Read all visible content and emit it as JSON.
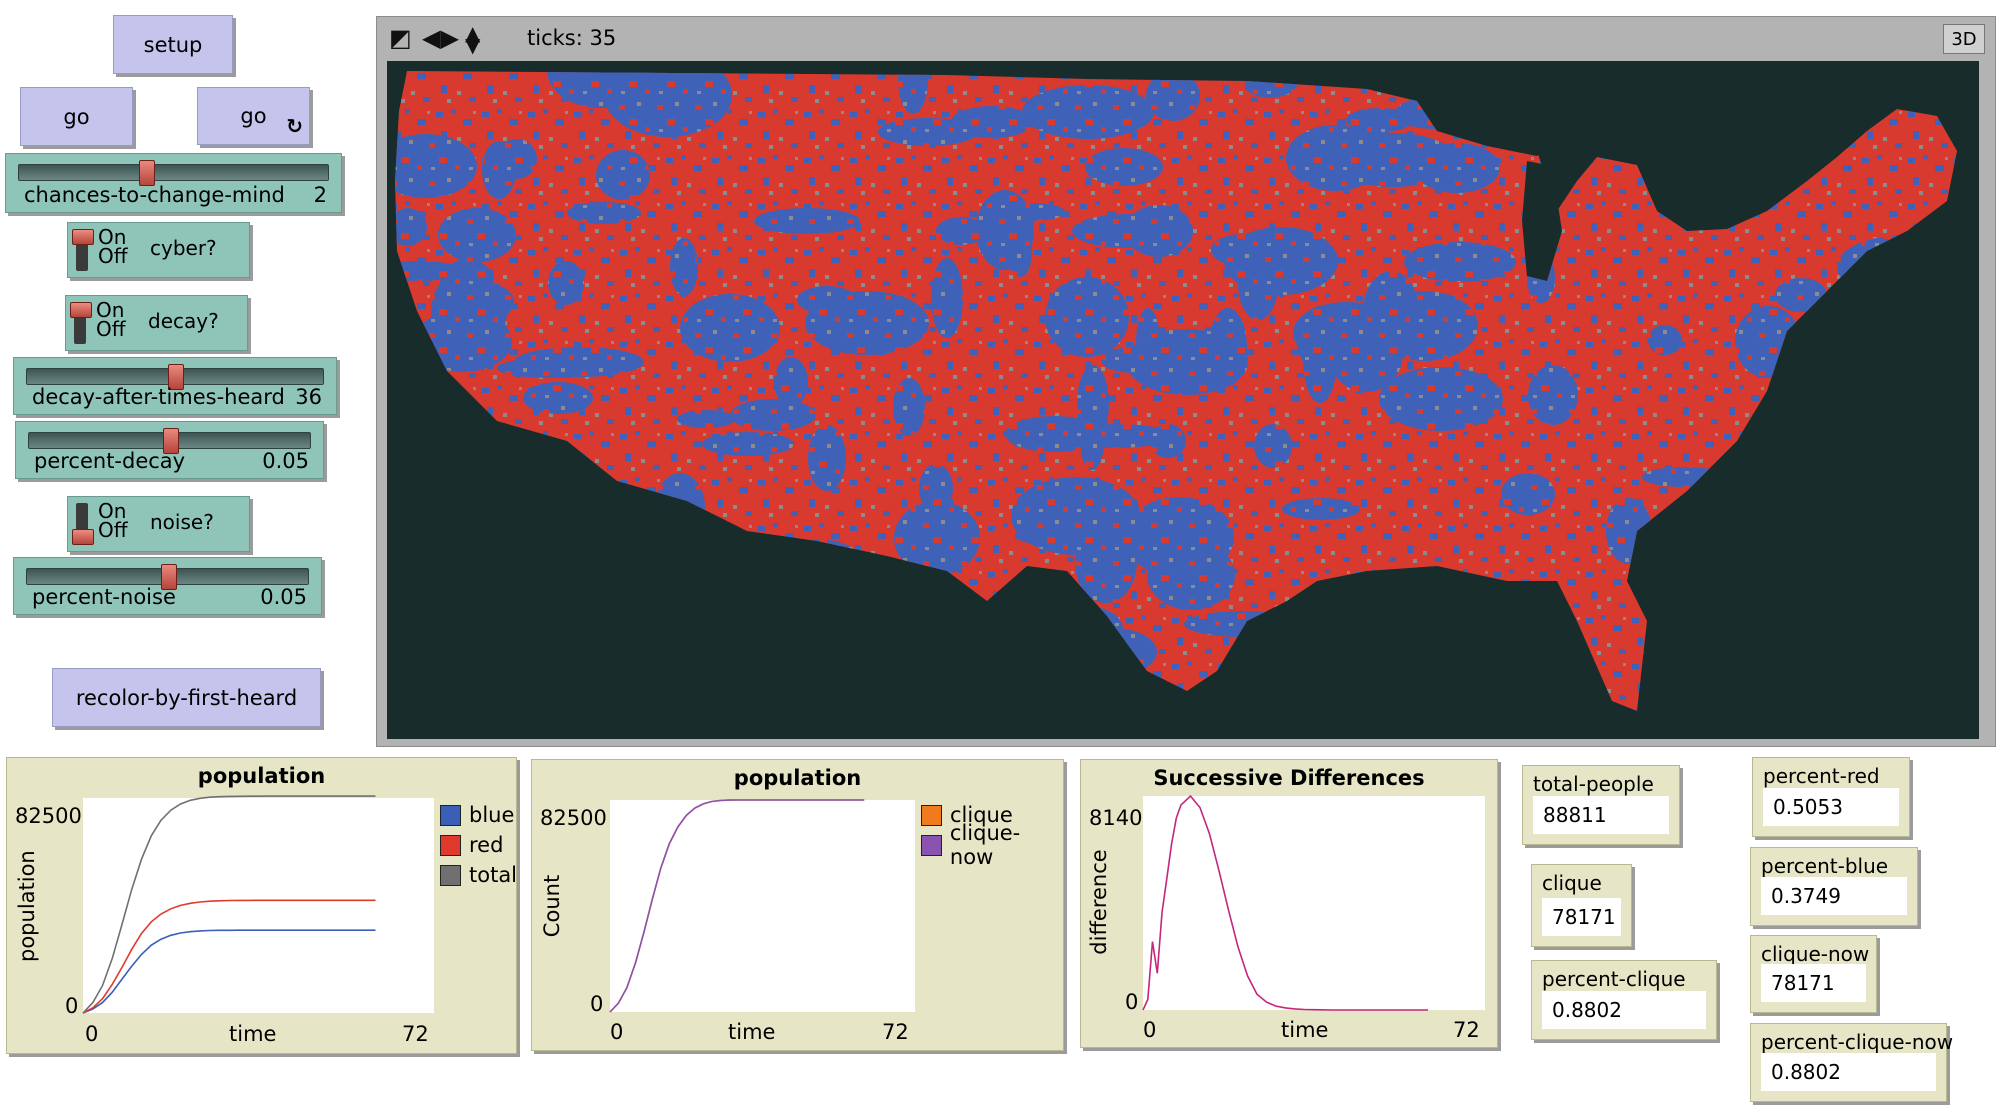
{
  "buttons": {
    "setup": "setup",
    "go_once": "go",
    "go_forever": "go",
    "recolor": "recolor-by-first-heard"
  },
  "sliders": [
    {
      "label": "chances-to-change-mind",
      "value": "2",
      "fraction": 0.41
    },
    {
      "label": "decay-after-times-heard",
      "value": "36",
      "fraction": 0.5
    },
    {
      "label": "percent-decay",
      "value": "0.05",
      "fraction": 0.5
    },
    {
      "label": "percent-noise",
      "value": "0.05",
      "fraction": 0.5
    }
  ],
  "switches": [
    {
      "label": "cyber?",
      "on": "On",
      "off": "Off",
      "state": "on"
    },
    {
      "label": "decay?",
      "on": "On",
      "off": "Off",
      "state": "on"
    },
    {
      "label": "noise?",
      "on": "On",
      "off": "Off",
      "state": "off"
    }
  ],
  "view": {
    "ticks_label": "ticks: 35",
    "three_d": "3D",
    "background_color": "#182c2c",
    "colors": {
      "blue": "#3f62b8",
      "red": "#d83a2f",
      "gray": "#8c8c8c"
    }
  },
  "chart_data": [
    {
      "type": "line",
      "title": "population",
      "xlabel": "time",
      "ylabel": "population",
      "x_range": [
        0,
        72
      ],
      "y_range": [
        0,
        82500
      ],
      "x_tick_labels": [
        "0",
        "72"
      ],
      "y_tick_labels": [
        "0",
        "82500"
      ],
      "legend": "right",
      "series": [
        {
          "name": "blue",
          "color": "#3a5fb8",
          "x": [
            0,
            2,
            4,
            6,
            8,
            10,
            12,
            14,
            16,
            18,
            20,
            22,
            24,
            26,
            28,
            30,
            32,
            34,
            36,
            38,
            40,
            44,
            48,
            52,
            56,
            60
          ],
          "y": [
            0,
            1500,
            4000,
            8000,
            13000,
            18000,
            22500,
            26000,
            28300,
            29800,
            30700,
            31200,
            31500,
            31650,
            31720,
            31750,
            31770,
            31780,
            31790,
            31790,
            31790,
            31790,
            31790,
            31790,
            31790,
            31790
          ]
        },
        {
          "name": "red",
          "color": "#e03a2c",
          "x": [
            0,
            2,
            4,
            6,
            8,
            10,
            12,
            14,
            16,
            18,
            20,
            22,
            24,
            26,
            28,
            30,
            32,
            34,
            36,
            38,
            40,
            44,
            48,
            52,
            56,
            60
          ],
          "y": [
            0,
            2000,
            5500,
            11000,
            17500,
            24500,
            30500,
            35000,
            38000,
            40000,
            41300,
            42100,
            42600,
            42900,
            43050,
            43150,
            43200,
            43220,
            43240,
            43250,
            43250,
            43250,
            43250,
            43250,
            43250,
            43250
          ]
        },
        {
          "name": "total",
          "color": "#707070",
          "x": [
            0,
            2,
            4,
            6,
            8,
            10,
            12,
            14,
            16,
            18,
            20,
            22,
            24,
            26,
            28,
            30,
            32,
            34,
            36,
            38,
            40,
            44,
            48,
            52,
            56,
            60
          ],
          "y": [
            0,
            4000,
            10500,
            21000,
            34000,
            47500,
            59000,
            68000,
            74000,
            77800,
            80200,
            81600,
            82400,
            82800,
            83000,
            83100,
            83150,
            83180,
            83200,
            83210,
            83210,
            83210,
            83210,
            83210,
            83210,
            83210
          ]
        }
      ]
    },
    {
      "type": "line",
      "title": "population",
      "xlabel": "time",
      "ylabel": "Count",
      "x_range": [
        0,
        72
      ],
      "y_range": [
        0,
        82500
      ],
      "x_tick_labels": [
        "0",
        "72"
      ],
      "y_tick_labels": [
        "0",
        "82500"
      ],
      "legend": "right",
      "series": [
        {
          "name": "clique",
          "color": "#f07a1c",
          "x": [
            0,
            2,
            4,
            6,
            8,
            10,
            12,
            14,
            16,
            18,
            20,
            22,
            24,
            26,
            28,
            30,
            32,
            34,
            36,
            38,
            40,
            44,
            48,
            52,
            56,
            60
          ],
          "y": [
            0,
            3500,
            9500,
            19000,
            31000,
            44000,
            56000,
            65500,
            72000,
            76500,
            79300,
            81000,
            81900,
            82300,
            82450,
            82500,
            82500,
            82500,
            82500,
            82500,
            82500,
            82500,
            82500,
            82500,
            82500,
            82500
          ]
        },
        {
          "name": "clique-now",
          "color": "#8b53b0",
          "x": [
            0,
            2,
            4,
            6,
            8,
            10,
            12,
            14,
            16,
            18,
            20,
            22,
            24,
            26,
            28,
            30,
            32,
            34,
            36,
            38,
            40,
            44,
            48,
            52,
            56,
            60
          ],
          "y": [
            0,
            3500,
            9500,
            19000,
            31000,
            44000,
            56000,
            65500,
            72000,
            76500,
            79300,
            81000,
            81900,
            82300,
            82450,
            82500,
            82500,
            82500,
            82500,
            82500,
            82500,
            82500,
            82500,
            82500,
            82500,
            82500
          ]
        }
      ]
    },
    {
      "type": "line",
      "title": "Successive Differences",
      "xlabel": "time",
      "ylabel": "difference",
      "x_range": [
        0,
        72
      ],
      "y_range": [
        0,
        8140
      ],
      "x_tick_labels": [
        "0",
        "72"
      ],
      "y_tick_labels": [
        "0",
        "8140"
      ],
      "series": [
        {
          "name": "",
          "color": "#c4267e",
          "x": [
            0,
            1,
            2,
            3,
            4,
            5,
            6,
            7,
            8,
            10,
            12,
            14,
            16,
            18,
            20,
            22,
            24,
            26,
            28,
            30,
            32,
            34,
            36,
            40,
            44,
            50,
            60
          ],
          "y": [
            0,
            400,
            2600,
            1400,
            3700,
            5000,
            6300,
            7300,
            7800,
            8140,
            7700,
            6700,
            5300,
            3800,
            2400,
            1300,
            600,
            300,
            150,
            80,
            40,
            20,
            10,
            0,
            0,
            0,
            0
          ]
        }
      ]
    }
  ],
  "plot_legends": [
    [
      "blue",
      "red",
      "total"
    ],
    [
      "clique",
      "clique-now"
    ]
  ],
  "monitors": {
    "total_people": {
      "label": "total-people",
      "value": "88811"
    },
    "clique": {
      "label": "clique",
      "value": "78171"
    },
    "percent_clique": {
      "label": "percent-clique",
      "value": "0.8802"
    },
    "percent_red": {
      "label": "percent-red",
      "value": "0.5053"
    },
    "percent_blue": {
      "label": "percent-blue",
      "value": "0.3749"
    },
    "clique_now": {
      "label": "clique-now",
      "value": "78171"
    },
    "percent_clique_now": {
      "label": "percent-clique-now",
      "value": "0.8802"
    }
  }
}
